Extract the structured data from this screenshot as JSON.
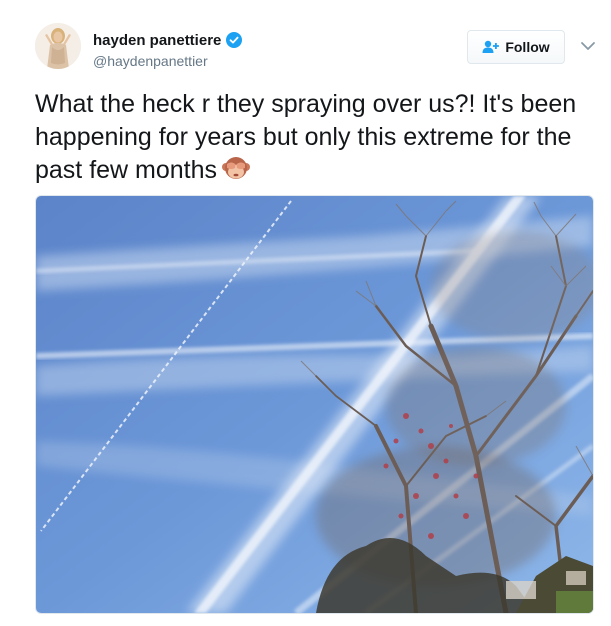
{
  "tweet": {
    "author": {
      "name": "hayden panettiere",
      "handle": "@haydenpanettier",
      "verified": true,
      "avatar_icon": "profile-photo"
    },
    "follow_button": {
      "label": "Follow",
      "icon": "add-user-icon"
    },
    "menu_icon": "chevron-down-icon",
    "text": "What the heck r they spraying over us?! It's been happening for years but only this extreme for the past few months",
    "emoji": "see-no-evil-monkey-emoji",
    "photo": {
      "description_icon": "sky-with-contrails-photo"
    }
  },
  "colors": {
    "verified_badge": "#1da1f2",
    "follow_icon": "#1da1f2",
    "handle": "#657786",
    "text": "#14171a",
    "button_border": "#e1e8ed"
  }
}
